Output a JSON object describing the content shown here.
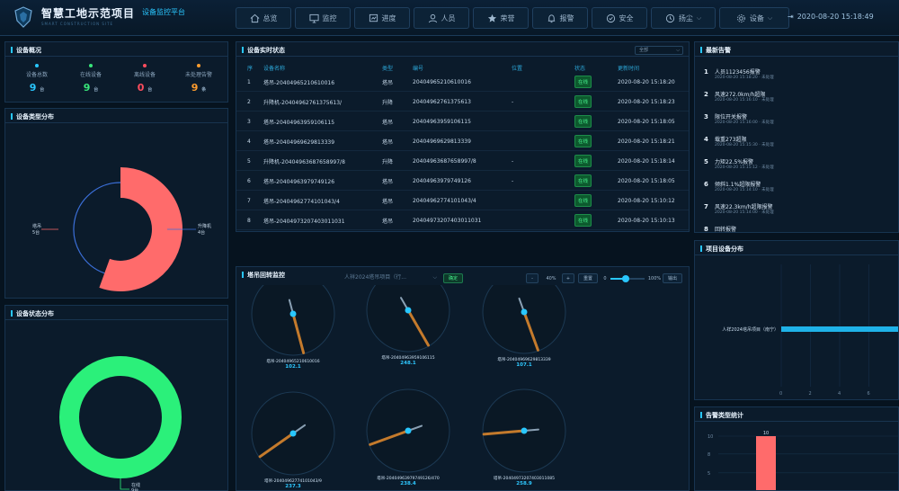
{
  "header": {
    "title": "智慧工地示范项目",
    "subtitle": "设备监控平台",
    "en_title": "SMART CONSTRUCTION SITE",
    "datetime": "2020-08-20 15:18:49"
  },
  "nav": [
    {
      "label": "总览",
      "icon": "home-icon"
    },
    {
      "label": "监控",
      "icon": "monitor-icon"
    },
    {
      "label": "进度",
      "icon": "progress-icon"
    },
    {
      "label": "人员",
      "icon": "user-icon"
    },
    {
      "label": "荣誉",
      "icon": "star-icon"
    },
    {
      "label": "报警",
      "icon": "bell-icon"
    },
    {
      "label": "安全",
      "icon": "check-circle-icon"
    },
    {
      "label": "扬尘",
      "icon": "clock-icon",
      "dropdown": true
    },
    {
      "label": "设备",
      "icon": "gear-icon",
      "dropdown": true
    }
  ],
  "overview": {
    "title": "设备概况",
    "stats": [
      {
        "label": "设备总数",
        "value": "9",
        "unit": "台",
        "color": "#29c7ff"
      },
      {
        "label": "在线设备",
        "value": "9",
        "unit": "台",
        "color": "#39e67a"
      },
      {
        "label": "离线设备",
        "value": "0",
        "unit": "台",
        "color": "#ff4d5e"
      },
      {
        "label": "未处理告警",
        "value": "9",
        "unit": "条",
        "color": "#ff9d2e"
      }
    ]
  },
  "type_chart": {
    "title": "设备类型分布",
    "chart_data": {
      "type": "pie",
      "slices": [
        {
          "label": "塔吊",
          "value": 5,
          "unit": "5台",
          "color": "#ff6b6b"
        },
        {
          "label": "升降机",
          "value": 4,
          "unit": "4台",
          "color": "#3b6fd8"
        }
      ]
    }
  },
  "status_chart": {
    "title": "设备状态分布",
    "chart_data": {
      "type": "pie",
      "slices": [
        {
          "label": "在线",
          "value": 9,
          "unit": "9台",
          "color": "#2bf07a"
        }
      ]
    }
  },
  "realtime": {
    "title": "设备实时状态",
    "filter": "全部",
    "columns": [
      "序",
      "设备名称",
      "类型",
      "编号",
      "位置",
      "状态",
      "更新时间"
    ],
    "rows": [
      {
        "no": "1",
        "name": "塔吊-20404965210610016",
        "type": "塔吊",
        "code": "20404965210610016",
        "loc": "",
        "status": "在线",
        "time": "2020-08-20 15:18:20"
      },
      {
        "no": "2",
        "name": "升降机-20404962761375613/",
        "type": "升降",
        "code": "20404962761375613",
        "loc": "-",
        "status": "在线",
        "time": "2020-08-20 15:18:23"
      },
      {
        "no": "3",
        "name": "塔吊-20404963959106115",
        "type": "塔吊",
        "code": "20404963959106115",
        "loc": "",
        "status": "在线",
        "time": "2020-08-20 15:18:05"
      },
      {
        "no": "4",
        "name": "塔吊-20404969629813339",
        "type": "塔吊",
        "code": "20404969629813339",
        "loc": "",
        "status": "在线",
        "time": "2020-08-20 15:18:21"
      },
      {
        "no": "5",
        "name": "升降机-20404963687658997/8",
        "type": "升降",
        "code": "20404963687658997/8",
        "loc": "-",
        "status": "在线",
        "time": "2020-08-20 15:18:14"
      },
      {
        "no": "6",
        "name": "塔吊-20404963979749126",
        "type": "塔吊",
        "code": "20404963979749126",
        "loc": "-",
        "status": "在线",
        "time": "2020-08-20 15:18:05"
      },
      {
        "no": "7",
        "name": "塔吊-20404962774101043/4",
        "type": "塔吊",
        "code": "20404962774101043/4",
        "loc": "",
        "status": "在线",
        "time": "2020-08-20 15:10:12"
      },
      {
        "no": "8",
        "name": "塔吊-20404973207403011031",
        "type": "塔吊",
        "code": "20404973207403011031",
        "loc": "",
        "status": "在线",
        "time": "2020-08-20 15:10:13"
      }
    ]
  },
  "gauges": {
    "title": "塔吊回转监控",
    "select_value": "人祥2024塔吊项目（行...",
    "confirm_label": "确定",
    "minus_label": "-",
    "zoom_label": "40%",
    "plus_label": "+",
    "reset_label": "重置",
    "slider_min": "0",
    "slider_max": "100%",
    "output_label": "输出",
    "slider_value": 0.45,
    "items": [
      {
        "label": "塔吊-20404965210610016",
        "value": "102.1",
        "angle": 165
      },
      {
        "label": "塔吊-20404963959106115",
        "value": "248.1",
        "angle": 150
      },
      {
        "label": "塔吊-20404969629813339",
        "value": "107.1",
        "angle": 160
      },
      {
        "label": "塔吊-20404962774101043/9",
        "value": "237.3",
        "angle": 235
      },
      {
        "label": "塔吊-20404963979749126/470",
        "value": "238.4",
        "angle": 250
      },
      {
        "label": "塔吊-20404973207403011085",
        "value": "258.9",
        "angle": 265
      }
    ]
  },
  "news": {
    "title": "最新告警",
    "items": [
      {
        "no": "1",
        "title": "人员1123456报警",
        "meta": "2020-08-20 15:18:20 · 未处理"
      },
      {
        "no": "2",
        "title": "风速272.0km/h超限",
        "meta": "2020-08-20 15:16:10 · 未处理"
      },
      {
        "no": "3",
        "title": "限位开关报警",
        "meta": "2020-08-20 15:16:00 · 未处理"
      },
      {
        "no": "4",
        "title": "载重273超限",
        "meta": "2020-08-20 15:15:30 · 未处理"
      },
      {
        "no": "5",
        "title": "力矩22.5%报警",
        "meta": "2020-08-20 15:15:12 · 未处理"
      },
      {
        "no": "6",
        "title": "倾斜1.1%超限报警",
        "meta": "2020-08-20 15:14:10 · 未处理"
      },
      {
        "no": "7",
        "title": "风速22.3km/h超限报警",
        "meta": "2020-08-20 15:14:00 · 未处理"
      },
      {
        "no": "8",
        "title": "回转报警",
        "meta": ""
      }
    ]
  },
  "project_chart": {
    "title": "项目设备分布",
    "chart_data": {
      "type": "bar",
      "orientation": "horizontal",
      "categories": [
        "人祥2024塔吊项目（南宁）"
      ],
      "values": [
        9
      ],
      "xlim": [
        0,
        8
      ],
      "xticks": [
        "0",
        "2",
        "4",
        "6"
      ]
    }
  },
  "alarm_chart": {
    "title": "告警类型统计",
    "chart_data": {
      "type": "bar",
      "categories": [
        ""
      ],
      "values": [
        10
      ],
      "yticks": [
        "10",
        "8",
        "5"
      ],
      "data_label": "10"
    }
  }
}
